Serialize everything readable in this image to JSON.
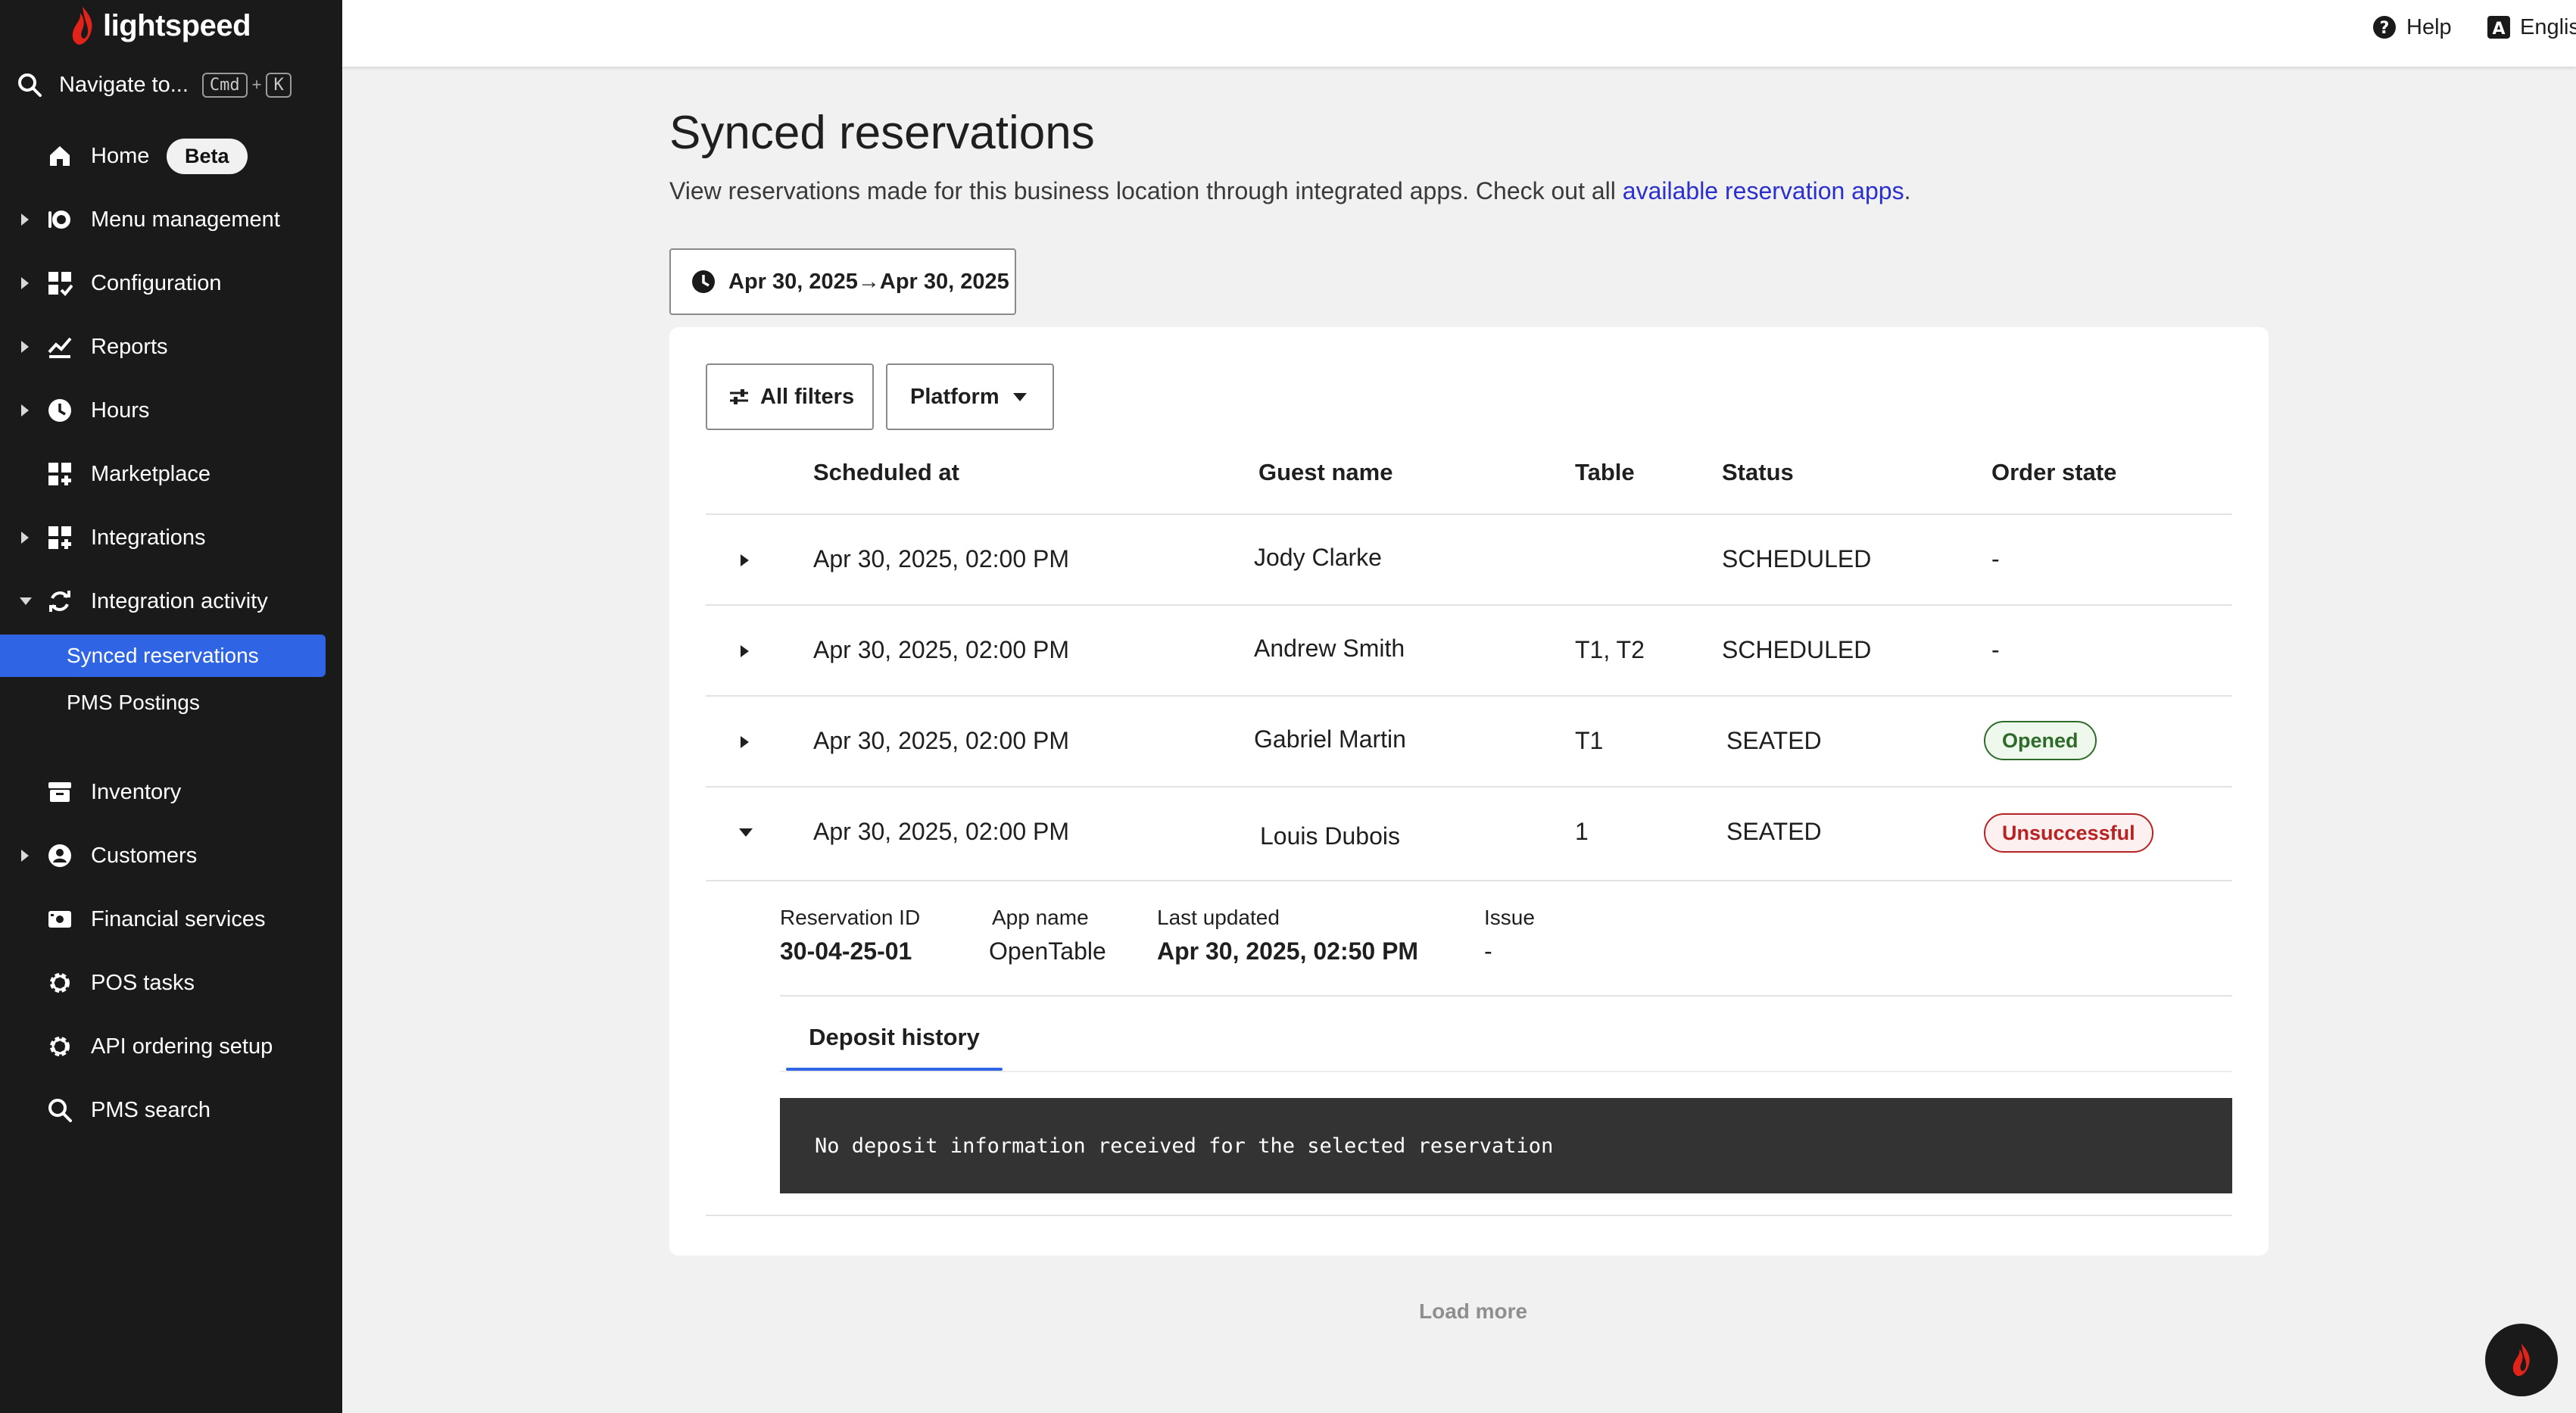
{
  "brand": {
    "name": "lightspeed"
  },
  "colors": {
    "accent": "#2f64e5",
    "brand_red": "#e2231a",
    "link": "#2a2fd0"
  },
  "sidebar": {
    "navigate": {
      "label": "Navigate to...",
      "key1": "Cmd",
      "plus": "+",
      "key2": "K"
    },
    "items": [
      {
        "label": "Home",
        "icon": "home-icon",
        "badge": "Beta"
      },
      {
        "label": "Menu management",
        "icon": "menu-management-icon"
      },
      {
        "label": "Configuration",
        "icon": "configuration-icon"
      },
      {
        "label": "Reports",
        "icon": "reports-icon"
      },
      {
        "label": "Hours",
        "icon": "clock-icon"
      },
      {
        "label": "Marketplace",
        "icon": "marketplace-icon"
      },
      {
        "label": "Integrations",
        "icon": "integrations-icon"
      },
      {
        "label": "Integration activity",
        "icon": "sync-icon"
      },
      {
        "label": "Inventory",
        "icon": "inventory-icon"
      },
      {
        "label": "Customers",
        "icon": "customers-icon"
      },
      {
        "label": "Financial services",
        "icon": "financial-services-icon"
      },
      {
        "label": "POS tasks",
        "icon": "gear-icon"
      },
      {
        "label": "API ordering setup",
        "icon": "gear-icon"
      },
      {
        "label": "PMS search",
        "icon": "search-icon"
      }
    ],
    "subitems": [
      {
        "label": "Synced reservations",
        "active": true
      },
      {
        "label": "PMS Postings",
        "active": false
      }
    ]
  },
  "header": {
    "help": "Help",
    "language": "English"
  },
  "main": {
    "title": "Synced reservations",
    "description": "View reservations made for this business location through integrated apps. Check out all ",
    "description_link": "available reservation apps",
    "description_end": ".",
    "date_range": "Apr 30, 2025→Apr 30, 2025",
    "filters": {
      "all_filters": "All filters",
      "platform": "Platform"
    },
    "table": {
      "columns": [
        "Scheduled at",
        "Guest name",
        "Table",
        "Status",
        "Order state"
      ],
      "rows": [
        {
          "scheduled_at": "Apr 30, 2025, 02:00 PM",
          "guest": "Jody Clarke",
          "table": "",
          "status": "SCHEDULED",
          "order_state": "-",
          "badge": ""
        },
        {
          "scheduled_at": "Apr 30, 2025, 02:00 PM",
          "guest": "Andrew Smith",
          "table": "T1, T2",
          "status": "SCHEDULED",
          "order_state": "-",
          "badge": ""
        },
        {
          "scheduled_at": "Apr 30, 2025, 02:00 PM",
          "guest": "Gabriel Martin",
          "table": "T1",
          "status": "SEATED",
          "order_state": "Opened",
          "badge": "success"
        },
        {
          "scheduled_at": "Apr 30, 2025, 02:00 PM",
          "guest": "Louis Dubois",
          "table": "1",
          "status": "SEATED",
          "order_state": "Unsuccessful",
          "badge": "error"
        }
      ]
    },
    "detail": {
      "reservation_id_label": "Reservation ID",
      "reservation_id": "30-04-25-01",
      "app_name_label": "App name",
      "app_name": "OpenTable",
      "last_updated_label": "Last updated",
      "last_updated": "Apr 30, 2025, 02:50 PM",
      "issue_label": "Issue",
      "issue": "-",
      "tab": "Deposit history",
      "deposit_message": "No deposit information received for the selected reservation"
    },
    "load_more": "Load more"
  }
}
